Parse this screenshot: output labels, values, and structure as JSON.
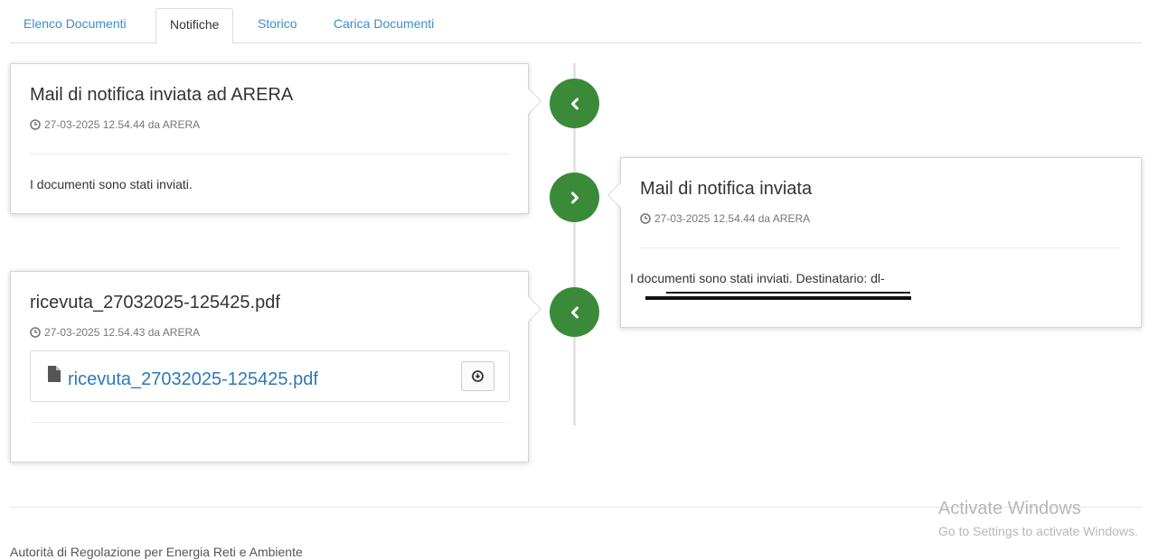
{
  "tabs": [
    {
      "label": "Elenco Documenti",
      "active": false
    },
    {
      "label": "Notifiche",
      "active": true
    },
    {
      "label": "Storico",
      "active": false
    },
    {
      "label": "Carica Documenti",
      "active": false
    }
  ],
  "timeline": [
    {
      "side": "left",
      "badge_icon": "chevron-left-icon",
      "title": "Mail di notifica inviata ad ARERA",
      "meta": "27-03-2025 12.54.44 da ARERA",
      "body": "I documenti sono stati inviati."
    },
    {
      "side": "right",
      "badge_icon": "chevron-right-icon",
      "title": "Mail di notifica inviata",
      "meta": "27-03-2025 12.54.44 da ARERA",
      "body_line1": "I documenti sono stati inviati. Destinatario: dl-",
      "body_line2_redacted": true
    },
    {
      "side": "left",
      "badge_icon": "chevron-left-icon",
      "title": "ricevuta_27032025-125425.pdf",
      "meta": "27-03-2025 12.54.43 da ARERA",
      "file": {
        "name": "ricevuta_27032025-125425.pdf",
        "icon": "file-icon",
        "action_icon": "download-icon"
      }
    }
  ],
  "footer": {
    "text": "Autorità di Regolazione per Energia Reti e Ambiente"
  },
  "watermark": {
    "title": "Activate Windows",
    "subtitle": "Go to Settings to activate Windows."
  },
  "colors": {
    "accent_link": "#3a8fc7",
    "badge_green": "#3b8a3a",
    "file_link": "#2a7ab8"
  }
}
